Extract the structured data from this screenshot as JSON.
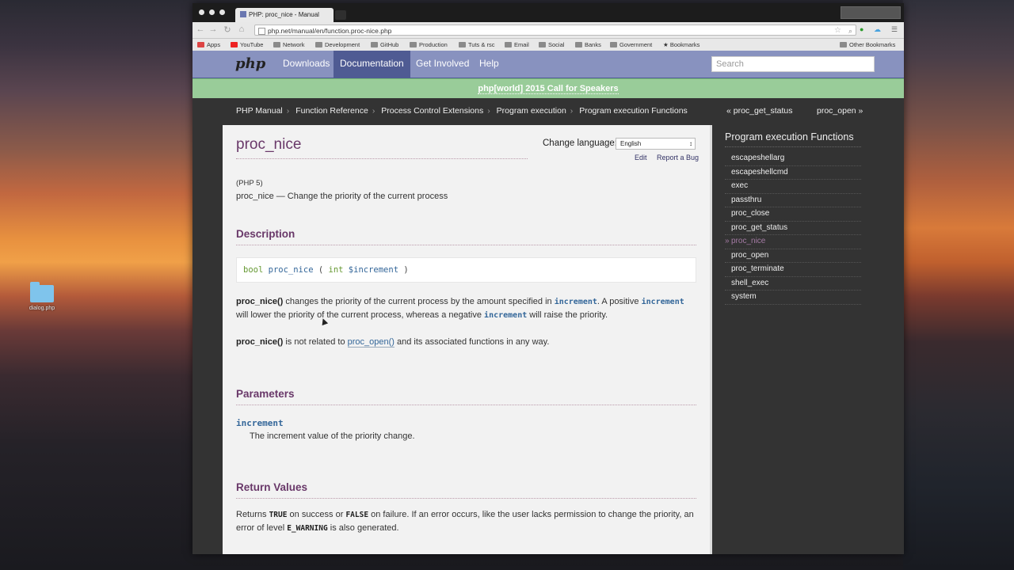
{
  "desktop": {
    "icon_label": "dialog.php"
  },
  "browser": {
    "tab_title": "PHP: proc_nice - Manual",
    "url": "php.net/manual/en/function.proc-nice.php",
    "bookmarks": [
      "Apps",
      "YouTube",
      "Network",
      "Development",
      "GitHub",
      "Production",
      "Tuts & rsc",
      "Email",
      "Social",
      "Banks",
      "Government",
      "Bookmarks",
      "Other Bookmarks"
    ]
  },
  "nav": {
    "logo": "php",
    "items": [
      "Downloads",
      "Documentation",
      "Get Involved",
      "Help"
    ],
    "active": "Documentation",
    "search_placeholder": "Search"
  },
  "banner": "php[world] 2015 Call for Speakers",
  "breadcrumb": [
    "PHP Manual",
    "Function Reference",
    "Process Control Extensions",
    "Program execution",
    "Program execution Functions"
  ],
  "prev": "« proc_get_status",
  "next": "proc_open »",
  "page": {
    "title": "proc_nice",
    "change_language": "Change language:",
    "language": "English",
    "edit": "Edit",
    "report_bug": "Report a Bug",
    "version": "(PHP 5)",
    "refpurpose": "proc_nice — Change the priority of the current process",
    "description_heading": "Description",
    "synopsis": {
      "type": "bool",
      "name": "proc_nice",
      "open": " ( ",
      "ptype": "int",
      "param": "$increment",
      "close": " )"
    },
    "desc1": {
      "fn": "proc_nice()",
      "t1": " changes the priority of the current process by the amount specified in ",
      "p1": "increment",
      "t2": ". A positive ",
      "p2": "increment",
      "t3": " will lower the priority of the current process, whereas a negative ",
      "p3": "increment",
      "t4": " will raise the priority."
    },
    "desc2": {
      "fn": "proc_nice()",
      "t1": " is not related to ",
      "link": "proc_open()",
      "t2": " and its associated functions in any way."
    },
    "parameters_heading": "Parameters",
    "param_name": "increment",
    "param_desc": "The increment value of the priority change.",
    "return_heading": "Return Values",
    "ret": {
      "t1": "Returns ",
      "true": "TRUE",
      "t2": " on success or ",
      "false": "FALSE",
      "t3": " on failure. If an error occurs, like the user lacks permission to change the priority, an error of level ",
      "warn": "E_WARNING",
      "t4": " is also generated."
    }
  },
  "sidebar": {
    "title": "Program execution Functions",
    "items": [
      "escapeshellarg",
      "escapeshellcmd",
      "exec",
      "passthru",
      "proc_close",
      "proc_get_status",
      "proc_nice",
      "proc_open",
      "proc_terminate",
      "shell_exec",
      "system"
    ],
    "current": "proc_nice"
  }
}
